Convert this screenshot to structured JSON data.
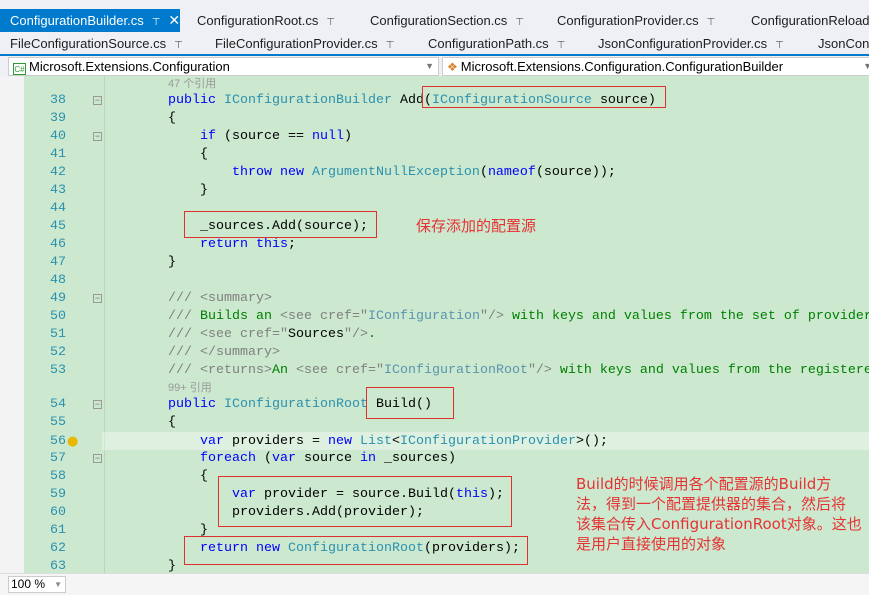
{
  "tabs_row1": [
    {
      "label": "ConfigurationBuilder.cs",
      "active": true
    },
    {
      "label": "ConfigurationRoot.cs"
    },
    {
      "label": "ConfigurationSection.cs"
    },
    {
      "label": "ConfigurationProvider.cs"
    },
    {
      "label": "ConfigurationReload"
    }
  ],
  "tabs_row2": [
    {
      "label": "FileConfigurationSource.cs"
    },
    {
      "label": "FileConfigurationProvider.cs"
    },
    {
      "label": "ConfigurationPath.cs"
    },
    {
      "label": "JsonConfigurationProvider.cs"
    },
    {
      "label": "JsonConf"
    }
  ],
  "icons": {
    "pin": "pin-icon",
    "close": "close-icon",
    "lightbulb": "lightbulb-icon"
  },
  "nav": {
    "namespace": "Microsoft.Extensions.Configuration",
    "class": "Microsoft.Extensions.Configuration.ConfigurationBuilder",
    "namespace_icon": "C#"
  },
  "colors": {
    "editor_bg": "#cce8cf",
    "keyword": "#0000ff",
    "type": "#2b91af",
    "comment": "#008000",
    "annotation": "#e53333",
    "active_tab": "#007acc"
  },
  "rows": [
    {
      "lens": "47 个引用"
    },
    {
      "num": "38",
      "fold": true,
      "t": [
        [
          "public ",
          "kw"
        ],
        [
          "IConfigurationBuilder ",
          "ty"
        ],
        [
          "Add(",
          "pl"
        ],
        [
          "IConfigurationSource ",
          "ty"
        ],
        [
          "source)",
          "pl"
        ]
      ]
    },
    {
      "num": "39",
      "t": [
        [
          "{",
          "pl"
        ]
      ]
    },
    {
      "num": "40",
      "fold": true,
      "t": [
        [
          "    if ",
          "kw"
        ],
        [
          "(source == ",
          "pl"
        ],
        [
          "null",
          "kw"
        ],
        [
          ")",
          "pl"
        ]
      ]
    },
    {
      "num": "41",
      "t": [
        [
          "    {",
          "pl"
        ]
      ]
    },
    {
      "num": "42",
      "t": [
        [
          "        throw new ",
          "kw"
        ],
        [
          "ArgumentNullException",
          "ty"
        ],
        [
          "(",
          "pl"
        ],
        [
          "nameof",
          "kw"
        ],
        [
          "(source));",
          "pl"
        ]
      ]
    },
    {
      "num": "43",
      "t": [
        [
          "    }",
          "pl"
        ]
      ]
    },
    {
      "num": "44",
      "t": []
    },
    {
      "num": "45",
      "t": [
        [
          "    _sources.Add(source);",
          "pl"
        ]
      ]
    },
    {
      "num": "46",
      "t": [
        [
          "    return this",
          "kw"
        ],
        [
          ";",
          "pl"
        ]
      ]
    },
    {
      "num": "47",
      "t": [
        [
          "}",
          "pl"
        ]
      ]
    },
    {
      "num": "48",
      "t": []
    },
    {
      "num": "49",
      "fold": true,
      "t": [
        [
          "/// <summary>",
          "dg"
        ]
      ]
    },
    {
      "num": "50",
      "t": [
        [
          "///",
          "dg"
        ],
        [
          " Builds an ",
          "cm"
        ],
        [
          "<see cref=\"",
          "dg"
        ],
        [
          "IConfiguration",
          "dv"
        ],
        [
          "\"/>",
          "dg"
        ],
        [
          " with keys and values from the set of providers",
          "cm"
        ]
      ]
    },
    {
      "num": "51",
      "t": [
        [
          "/// <see cref=\"",
          "dg"
        ],
        [
          "Sources",
          "pl"
        ],
        [
          "\"/>",
          "dg"
        ],
        [
          ".",
          "cm"
        ]
      ]
    },
    {
      "num": "52",
      "t": [
        [
          "/// </summary>",
          "dg"
        ]
      ]
    },
    {
      "num": "53",
      "t": [
        [
          "/// <returns>",
          "dg"
        ],
        [
          "An ",
          "cm"
        ],
        [
          "<see cref=\"",
          "dg"
        ],
        [
          "IConfigurationRoot",
          "dv"
        ],
        [
          "\"/>",
          "dg"
        ],
        [
          " with keys and values from the registered providers",
          "cm"
        ]
      ]
    },
    {
      "lens": "99+ 引用"
    },
    {
      "num": "54",
      "fold": true,
      "t": [
        [
          "public ",
          "kw"
        ],
        [
          "IConfigurationRoot ",
          "ty"
        ],
        [
          "Build()",
          "pl"
        ]
      ]
    },
    {
      "num": "55",
      "t": [
        [
          "{",
          "pl"
        ]
      ]
    },
    {
      "num": "56",
      "bulb": true,
      "cur": true,
      "t": [
        [
          "    var ",
          "kw"
        ],
        [
          "providers = ",
          "pl"
        ],
        [
          "new ",
          "kw"
        ],
        [
          "List",
          "ty"
        ],
        [
          "<",
          "pl"
        ],
        [
          "IConfigurationProvider",
          "ty"
        ],
        [
          ">();",
          "pl"
        ]
      ]
    },
    {
      "num": "57",
      "fold": true,
      "t": [
        [
          "    foreach ",
          "kw"
        ],
        [
          "(",
          "pl"
        ],
        [
          "var ",
          "kw"
        ],
        [
          "source ",
          "pl"
        ],
        [
          "in ",
          "kw"
        ],
        [
          "_sources)",
          "pl"
        ]
      ]
    },
    {
      "num": "58",
      "t": [
        [
          "    {",
          "pl"
        ]
      ]
    },
    {
      "num": "59",
      "t": [
        [
          "        var ",
          "kw"
        ],
        [
          "provider = source.Build(",
          "pl"
        ],
        [
          "this",
          "kw"
        ],
        [
          ");",
          "pl"
        ]
      ]
    },
    {
      "num": "60",
      "t": [
        [
          "        providers.Add(provider);",
          "pl"
        ]
      ]
    },
    {
      "num": "61",
      "t": [
        [
          "    }",
          "pl"
        ]
      ]
    },
    {
      "num": "62",
      "t": [
        [
          "    return new ",
          "kw"
        ],
        [
          "ConfigurationRoot",
          "ty"
        ],
        [
          "(providers);",
          "pl"
        ]
      ]
    },
    {
      "num": "63",
      "t": [
        [
          "}",
          "pl"
        ]
      ]
    }
  ],
  "annotations": {
    "add_source": "保存添加的配置源",
    "build_lines": [
      "Build的时候调用各个配置源的Build方",
      "法，得到一个配置提供器的集合，然后将",
      "该集合传入ConfigurationRoot对象。这也",
      "是用户直接使用的对象"
    ]
  },
  "status": {
    "zoom": "100 %"
  }
}
